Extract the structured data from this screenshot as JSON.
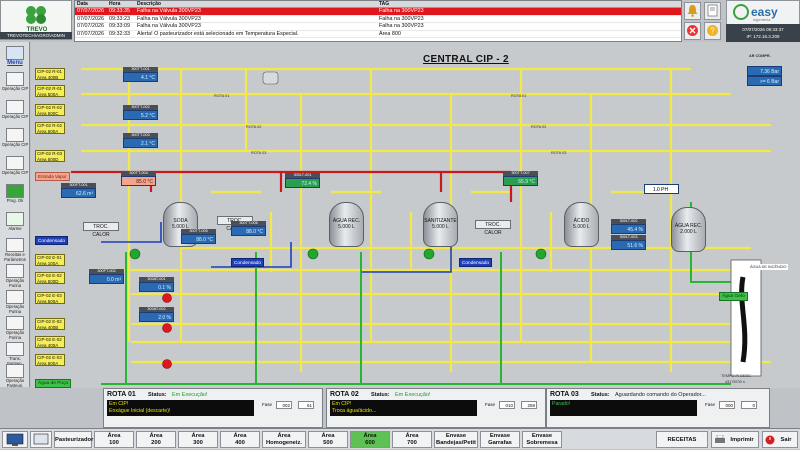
{
  "header": {
    "logo_text": "TREVO",
    "user": "TREVOTECH\\AGRO\\ADMIN",
    "brand": "easy",
    "brand_sub": "ingenieria",
    "datetime": "07/07/2026 09:33:37",
    "ip": "IP: 172.16.3.209"
  },
  "alarms": {
    "columns": {
      "date": "Data",
      "time": "Hora",
      "desc": "Descrição",
      "tag": "TAG"
    },
    "rows": [
      {
        "date": "07/07/2026",
        "time": "09:33:35",
        "desc": "Falha na Válvula 300VP23",
        "tag": "Falha na 300VP23",
        "active": true
      },
      {
        "date": "07/07/2026",
        "time": "09:33:23",
        "desc": "Falha na Válvula 300VP23",
        "tag": "Falha na 300VP23",
        "active": false
      },
      {
        "date": "07/07/2026",
        "time": "09:33:09",
        "desc": "Falha na Válvula 300VP23",
        "tag": "Falha na 300VP23",
        "active": false
      },
      {
        "date": "07/07/2026",
        "time": "09:32:33",
        "desc": "Alerta! O pasteurizador está selecionado em Temperatura Especial.",
        "tag": "Área 800",
        "active": false
      }
    ]
  },
  "left_nav": [
    {
      "label": "Menu"
    },
    {
      "label": "Operação CIP"
    },
    {
      "label": "Operação CIP"
    },
    {
      "label": "Operação CIP"
    },
    {
      "label": "Operação CIP"
    },
    {
      "label": "Prog. Ok"
    },
    {
      "label": "Alarme"
    },
    {
      "label": "Receitas e Parâmetros"
    },
    {
      "label": "Operação Purina"
    },
    {
      "label": "Operação Purina"
    },
    {
      "label": "Operação Purina"
    },
    {
      "label": "Trans. Fermen."
    },
    {
      "label": "Operação Pasteuri."
    }
  ],
  "scada": {
    "title": "CENTRAL CIP - 2",
    "destinations": [
      {
        "code": "CIP-02 R-01",
        "area": "Área 400B"
      },
      {
        "code": "CIP-02 R-01",
        "area": "Área 500A"
      },
      {
        "code": "CIP-02 R-02",
        "area": "Área 500C"
      },
      {
        "code": "CIP-02 R-02",
        "area": "Área 500A"
      },
      {
        "code": "CIP-02 R-03",
        "area": "Área 500D"
      },
      {
        "code": "CIP-02 E-01",
        "area": "Área 100A"
      },
      {
        "code": "CIP-02 E-02",
        "area": "Área 500D"
      },
      {
        "code": "CIP-02 E-03",
        "area": "Área 500A"
      },
      {
        "code": "CIP-02 E-02",
        "area": "Área 400B"
      },
      {
        "code": "CIP-02 E-02",
        "area": "Área 400A"
      },
      {
        "code": "CIP-02 E-03",
        "area": "Área 500A"
      }
    ],
    "tanks": [
      {
        "name": "SODA",
        "cap": "5.000 L"
      },
      {
        "name": "ÁGUA REC.",
        "cap": "5.000 L"
      },
      {
        "name": "SANITIZANTE",
        "cap": "5.000 L"
      },
      {
        "name": "ÁCIDO",
        "cap": "5.000 L"
      },
      {
        "name": "ÁGUA REC.",
        "cap": "2.000 L"
      }
    ],
    "readings": [
      {
        "tag": "300TT-001",
        "value": "4.1 °C"
      },
      {
        "tag": "300TT-002",
        "value": "5.2 °C"
      },
      {
        "tag": "300TT-003",
        "value": "2.1 °C"
      },
      {
        "tag": "300FT-001",
        "value": "62.6 m³"
      },
      {
        "tag": "300TT-004",
        "value": "85.0 °C"
      },
      {
        "tag": "300TT-005",
        "value": "88.0 °C"
      },
      {
        "tag": "300TT-006",
        "value": "88.0 °C"
      },
      {
        "tag": "300LT-001",
        "value": "72.4 %"
      },
      {
        "tag": "300TT-007",
        "value": "65.9 °C"
      },
      {
        "tag": "300LT-002",
        "value": "45.4 %"
      },
      {
        "tag": "300LT-003",
        "value": "51.6 %"
      },
      {
        "tag": "300FT-002",
        "value": "0.0 m³"
      },
      {
        "tag": "300AT-001",
        "value": "0.1 %"
      },
      {
        "tag": "300AT-002",
        "value": "2.0 %"
      }
    ],
    "ar_comp": {
      "label": "AR COMPR.",
      "value": "7.36 Bar",
      "limit": ">= 6 Bar"
    },
    "dosing": {
      "value": "1.0 PH"
    },
    "inputs": {
      "steam": "Entrada Vapor",
      "water": "Água de Poço",
      "water_in": "Água Gelo"
    },
    "buttons": {
      "condensado1": "Condensado",
      "condensado2": "Condensado",
      "condensado3": "Condensado"
    },
    "hx": [
      "TROC. CALOR",
      "TROC. CALOR",
      "TROC. CALOR"
    ],
    "incendio": "ÁGUA DE INCÊNDIO",
    "tempo": {
      "label": "TEMPO P/ DESC.",
      "value": "43178700 s"
    },
    "routes_labels": [
      "ROTA 01",
      "ROTA 02",
      "ROTA 03"
    ]
  },
  "routes": [
    {
      "title": "ROTA 01",
      "status_label": "Status:",
      "status": "Em Execução!",
      "line1": "Em CIP!",
      "line2": "Enxágue Inicial (descarte)!",
      "fase_label": "Fase",
      "fase": "002",
      "value": "61"
    },
    {
      "title": "ROTA 02",
      "status_label": "Status:",
      "status": "Em Execução!",
      "line1": "Em CIP!",
      "line2": "Troca água/ácido...",
      "fase_label": "Fase",
      "fase": "010",
      "value": "259"
    },
    {
      "title": "ROTA 03",
      "status_label": "Status:",
      "status": "Aguardando comando do Operador...",
      "line1": "Parado!",
      "line2": "",
      "fase_label": "Fase",
      "fase": "000",
      "value": "0"
    }
  ],
  "bottom_nav": [
    {
      "l1": "Pasteurizador",
      "l2": ""
    },
    {
      "l1": "Área",
      "l2": "100"
    },
    {
      "l1": "Área",
      "l2": "200"
    },
    {
      "l1": "Área",
      "l2": "300"
    },
    {
      "l1": "Área",
      "l2": "400"
    },
    {
      "l1": "Área",
      "l2": "Homogeneiz."
    },
    {
      "l1": "Área",
      "l2": "500"
    },
    {
      "l1": "Área",
      "l2": "600"
    },
    {
      "l1": "Área",
      "l2": "700"
    },
    {
      "l1": "Envase",
      "l2": "Bandejas/Petit"
    },
    {
      "l1": "Envase",
      "l2": "Garrafas"
    },
    {
      "l1": "Envase",
      "l2": "Sobremesa"
    }
  ],
  "bottom_actions": {
    "receitas": "RECEITAS",
    "imprimir": "Imprimir",
    "sair": "Sair"
  },
  "colors": {
    "pipe_yellow": "#f3e84a",
    "pipe_red": "#c8191c",
    "alarm_red": "#e1171e",
    "tag_blue": "#2a6ab3",
    "active_green": "#5ec153"
  }
}
